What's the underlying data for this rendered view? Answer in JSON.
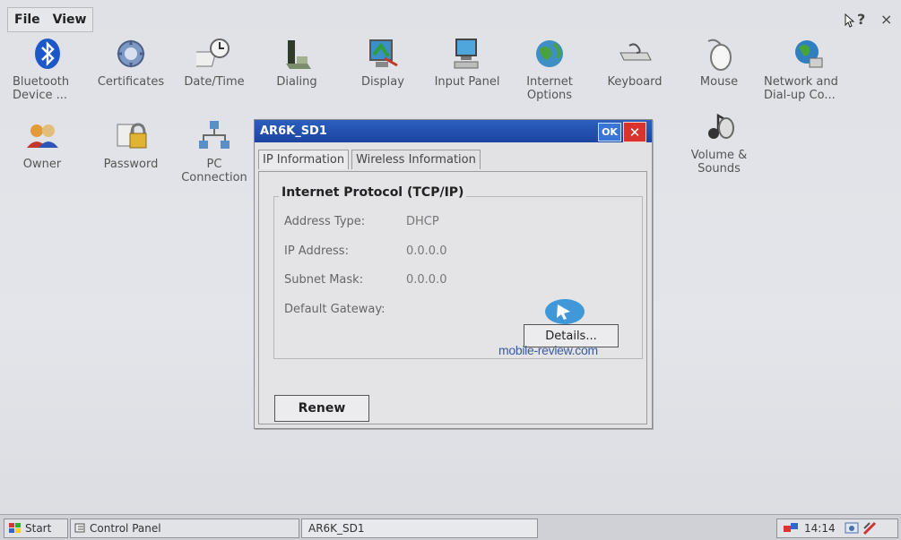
{
  "menu": {
    "file": "File",
    "view": "View",
    "help": "?",
    "close": "×"
  },
  "icons": [
    {
      "label": "Bluetooth\nDevice ...",
      "icon": "bluetooth-icon"
    },
    {
      "label": "Certificates",
      "icon": "certificates-icon"
    },
    {
      "label": "Date/Time",
      "icon": "clock-icon"
    },
    {
      "label": "Dialing",
      "icon": "dialing-icon"
    },
    {
      "label": "Display",
      "icon": "display-icon"
    },
    {
      "label": "Input Panel",
      "icon": "input-panel-icon"
    },
    {
      "label": "Internet\nOptions",
      "icon": "globe-icon"
    },
    {
      "label": "Keyboard",
      "icon": "keyboard-icon"
    },
    {
      "label": "Mouse",
      "icon": "mouse-icon"
    },
    {
      "label": "Network and\nDial-up Co...",
      "icon": "network-icon"
    },
    {
      "label": "Owner",
      "icon": "owner-icon"
    },
    {
      "label": "Password",
      "icon": "password-icon"
    },
    {
      "label": "PC\nConnection",
      "icon": "pc-connection-icon"
    },
    {
      "label": "Volume &\nSounds",
      "icon": "volume-icon"
    }
  ],
  "dialog": {
    "title": "AR6K_SD1",
    "ok": "OK",
    "close": "✕",
    "tabs": [
      "IP Information",
      "Wireless Information"
    ],
    "group_title": "Internet Protocol (TCP/IP)",
    "rows": [
      {
        "label": "Address Type:",
        "value": "DHCP"
      },
      {
        "label": "IP Address:",
        "value": "0.0.0.0"
      },
      {
        "label": "Subnet Mask:",
        "value": "0.0.0.0"
      },
      {
        "label": "Default Gateway:",
        "value": ""
      }
    ],
    "details_button": "Details...",
    "renew_button": "Renew"
  },
  "watermark": "mobile-review.com",
  "taskbar": {
    "start": "Start",
    "control_panel": "Control Panel",
    "task": "AR6K_SD1",
    "time": "14:14"
  }
}
